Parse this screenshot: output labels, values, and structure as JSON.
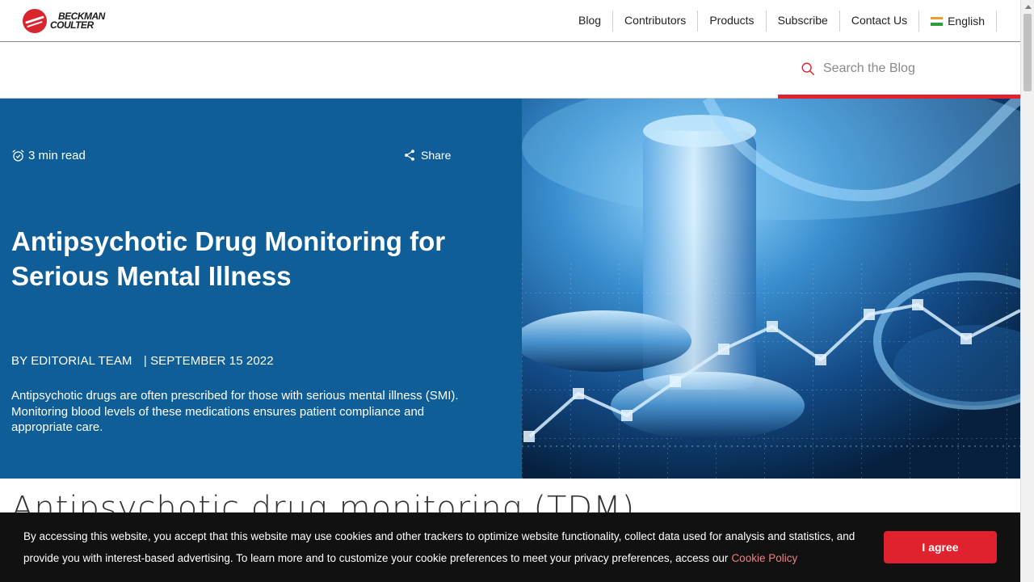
{
  "brand": {
    "logo_line1": "BECKMAN",
    "logo_line2": "COULTER",
    "brand_color": "#d9262e"
  },
  "nav": {
    "items": [
      {
        "label": "Blog"
      },
      {
        "label": "Contributors"
      },
      {
        "label": "Products"
      },
      {
        "label": "Subscribe"
      },
      {
        "label": "Contact Us"
      }
    ],
    "language": {
      "label": "English",
      "flag_icon": "india-flag-icon"
    }
  },
  "search": {
    "placeholder": "Search the Blog",
    "icon": "search-icon",
    "accent": "#e0212e"
  },
  "hero": {
    "background": "#0f5e98",
    "read_time": "3 min read",
    "read_time_icon": "alarm-clock-icon",
    "share_label": "Share",
    "share_icon": "share-icon",
    "title": "Antipsychotic Drug Monitoring for Serious Mental Illness",
    "author": "BY EDITORIAL TEAM",
    "date": "| SEPTEMBER 15 2022",
    "summary": "Antipsychotic drugs are often prescribed for those with serious mental illness (SMI). Monitoring blood levels of these medications ensures patient compliance and appropriate care."
  },
  "article": {
    "heading": "Antipsychotic drug monitoring (TDM)"
  },
  "cookie_banner": {
    "text": "By accessing this website, you accept that this website may use cookies and other trackers to optimize website functionality, collect data used for analysis and statistics, and provide you with interest-based advertising. To learn more and to customize your cookie preferences to meet your privacy preferences, access our",
    "link_label": "Cookie Policy",
    "button_label": "I agree",
    "button_color": "#e0212e"
  }
}
